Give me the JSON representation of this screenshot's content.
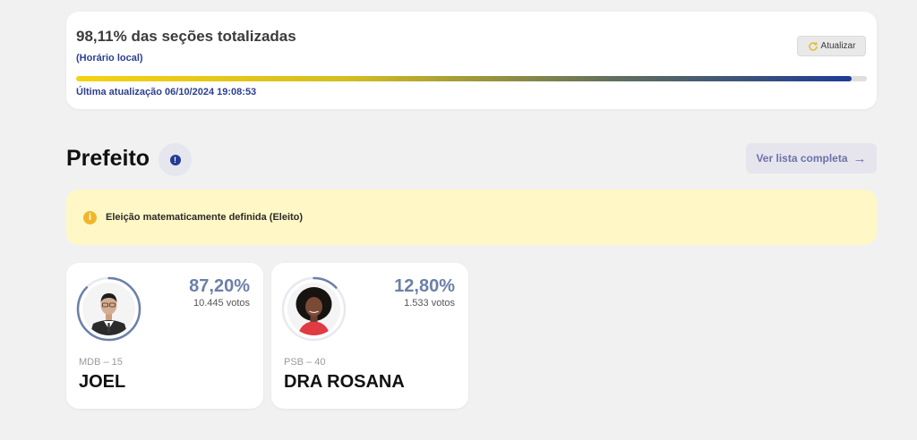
{
  "status": {
    "percent_text": "98,11% das seções totalizadas",
    "local_time_label": "(Horário local)",
    "refresh_label": "Atualizar",
    "progress_fraction": 0.9811,
    "last_update": "Última atualização 06/10/2024 19:08:53"
  },
  "office": {
    "title": "Prefeito",
    "info_icon": "info-icon",
    "full_list_label": "Ver lista completa",
    "arrow": "→"
  },
  "notice": {
    "icon": "i",
    "message": "Eleição matematicamente definida (Eleito)"
  },
  "candidates": [
    {
      "percent": "87,20%",
      "votes": "10.445 votos",
      "party": "MDB – 15",
      "name": "JOEL",
      "share": 0.872
    },
    {
      "percent": "12,80%",
      "votes": "1.533 votos",
      "party": "PSB – 40",
      "name": "DRA ROSANA",
      "share": 0.128
    }
  ],
  "colors": {
    "accent_blue": "#233a95",
    "progress_start": "#f4d312",
    "progress_end": "#1f3b96",
    "notice_bg": "#fff8c6",
    "ring": "#6b80a8"
  }
}
